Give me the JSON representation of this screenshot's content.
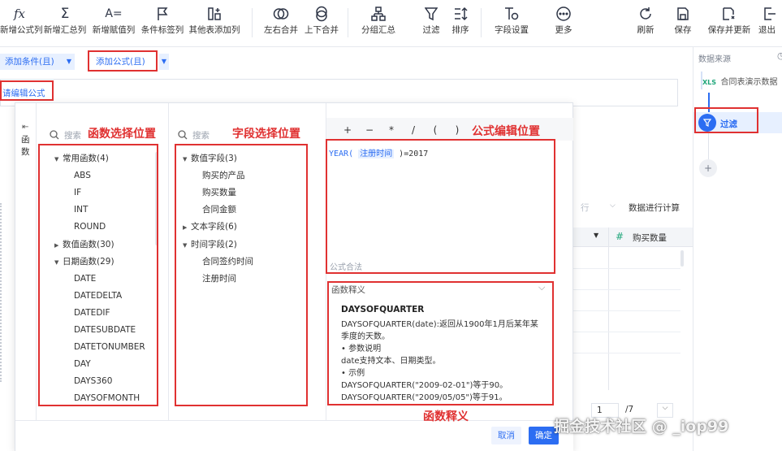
{
  "toolbar": {
    "items": [
      {
        "label": "新增公式列",
        "icon": "fx-icon"
      },
      {
        "label": "新增汇总列",
        "icon": "sigma-icon"
      },
      {
        "label": "新增赋值列",
        "icon": "assign-icon"
      },
      {
        "label": "条件标签列",
        "icon": "flag-icon"
      },
      {
        "label": "其他表添加列",
        "icon": "add-column-icon"
      },
      {
        "label": "左右合并",
        "icon": "merge-horizontal-icon"
      },
      {
        "label": "上下合并",
        "icon": "merge-vertical-icon"
      },
      {
        "label": "分组汇总",
        "icon": "group-icon"
      },
      {
        "label": "过滤",
        "icon": "filter-icon"
      },
      {
        "label": "排序",
        "icon": "sort-icon"
      },
      {
        "label": "字段设置",
        "icon": "field-settings-icon"
      },
      {
        "label": "更多",
        "icon": "more-icon"
      },
      {
        "label": "刷新",
        "icon": "refresh-icon"
      },
      {
        "label": "保存",
        "icon": "save-icon"
      },
      {
        "label": "保存并更新",
        "icon": "save-update-icon"
      },
      {
        "label": "退出",
        "icon": "exit-icon"
      }
    ]
  },
  "conditions": {
    "add_condition": "添加条件(且)",
    "add_formula": "添加公式(且)",
    "formula_hint": "请编辑公式"
  },
  "side_panel": {
    "title": "数据来源",
    "source_icon": "XLS",
    "source_name": "合同表演示数据",
    "filter_step": "过滤",
    "add_step": "+"
  },
  "background": {
    "hint_left": "行",
    "hint_right": "数据进行计算",
    "col_hash": "#",
    "col_name": "购买数量",
    "pagination_current": "1",
    "pagination_total": "/7"
  },
  "dialog": {
    "side_tab": "函数",
    "func_search_placeholder": "搜索",
    "field_search_placeholder": "搜索",
    "func_tree": [
      {
        "label": "常用函数(4)",
        "level": 0,
        "expanded": true
      },
      {
        "label": "ABS",
        "level": 1
      },
      {
        "label": "IF",
        "level": 1
      },
      {
        "label": "INT",
        "level": 1
      },
      {
        "label": "ROUND",
        "level": 1
      },
      {
        "label": "数值函数(30)",
        "level": 0,
        "expanded": false
      },
      {
        "label": "日期函数(29)",
        "level": 0,
        "expanded": true
      },
      {
        "label": "DATE",
        "level": 1
      },
      {
        "label": "DATEDELTA",
        "level": 1
      },
      {
        "label": "DATEDIF",
        "level": 1
      },
      {
        "label": "DATESUBDATE",
        "level": 1
      },
      {
        "label": "DATETONUMBER",
        "level": 1
      },
      {
        "label": "DAY",
        "level": 1
      },
      {
        "label": "DAYS360",
        "level": 1
      },
      {
        "label": "DAYSOFMONTH",
        "level": 1
      }
    ],
    "field_tree": [
      {
        "label": "数值字段(3)",
        "level": 0,
        "expanded": true
      },
      {
        "label": "购买的产品",
        "level": 1
      },
      {
        "label": "购买数量",
        "level": 1
      },
      {
        "label": "合同金额",
        "level": 1
      },
      {
        "label": "文本字段(6)",
        "level": 0,
        "expanded": false
      },
      {
        "label": "时间字段(2)",
        "level": 0,
        "expanded": true
      },
      {
        "label": "合同签约时间",
        "level": 1
      },
      {
        "label": "注册时间",
        "level": 1
      }
    ],
    "operators": [
      "+",
      "−",
      "*",
      "/",
      "(",
      ")"
    ],
    "formula": {
      "func": "YEAR(",
      "field": "注册时间",
      "rest": ")=2017"
    },
    "formula_status": "公式合法",
    "explain": {
      "header": "函数释义",
      "title": "DAYSOFQUARTER",
      "lines": [
        "DAYSOFQUARTER(date):返回从1900年1月后某年某",
        "季度的天数。",
        "• 参数说明",
        "date支持文本、日期类型。",
        "• 示例",
        "DAYSOFQUARTER(\"2009-02-01\")等于90。",
        "DAYSOFQUARTER(\"2009/05/05\")等于91。"
      ]
    },
    "cancel": "取消",
    "confirm": "确定"
  },
  "annotations": {
    "func_area": "函数选择位置",
    "field_area": "字段选择位置",
    "formula_area": "公式编辑位置",
    "explain_area": "函数释义"
  },
  "watermark": "掘金技术社区 @ _iop99",
  "colors": {
    "accent": "#2c6df2",
    "annotation": "#e03131"
  }
}
